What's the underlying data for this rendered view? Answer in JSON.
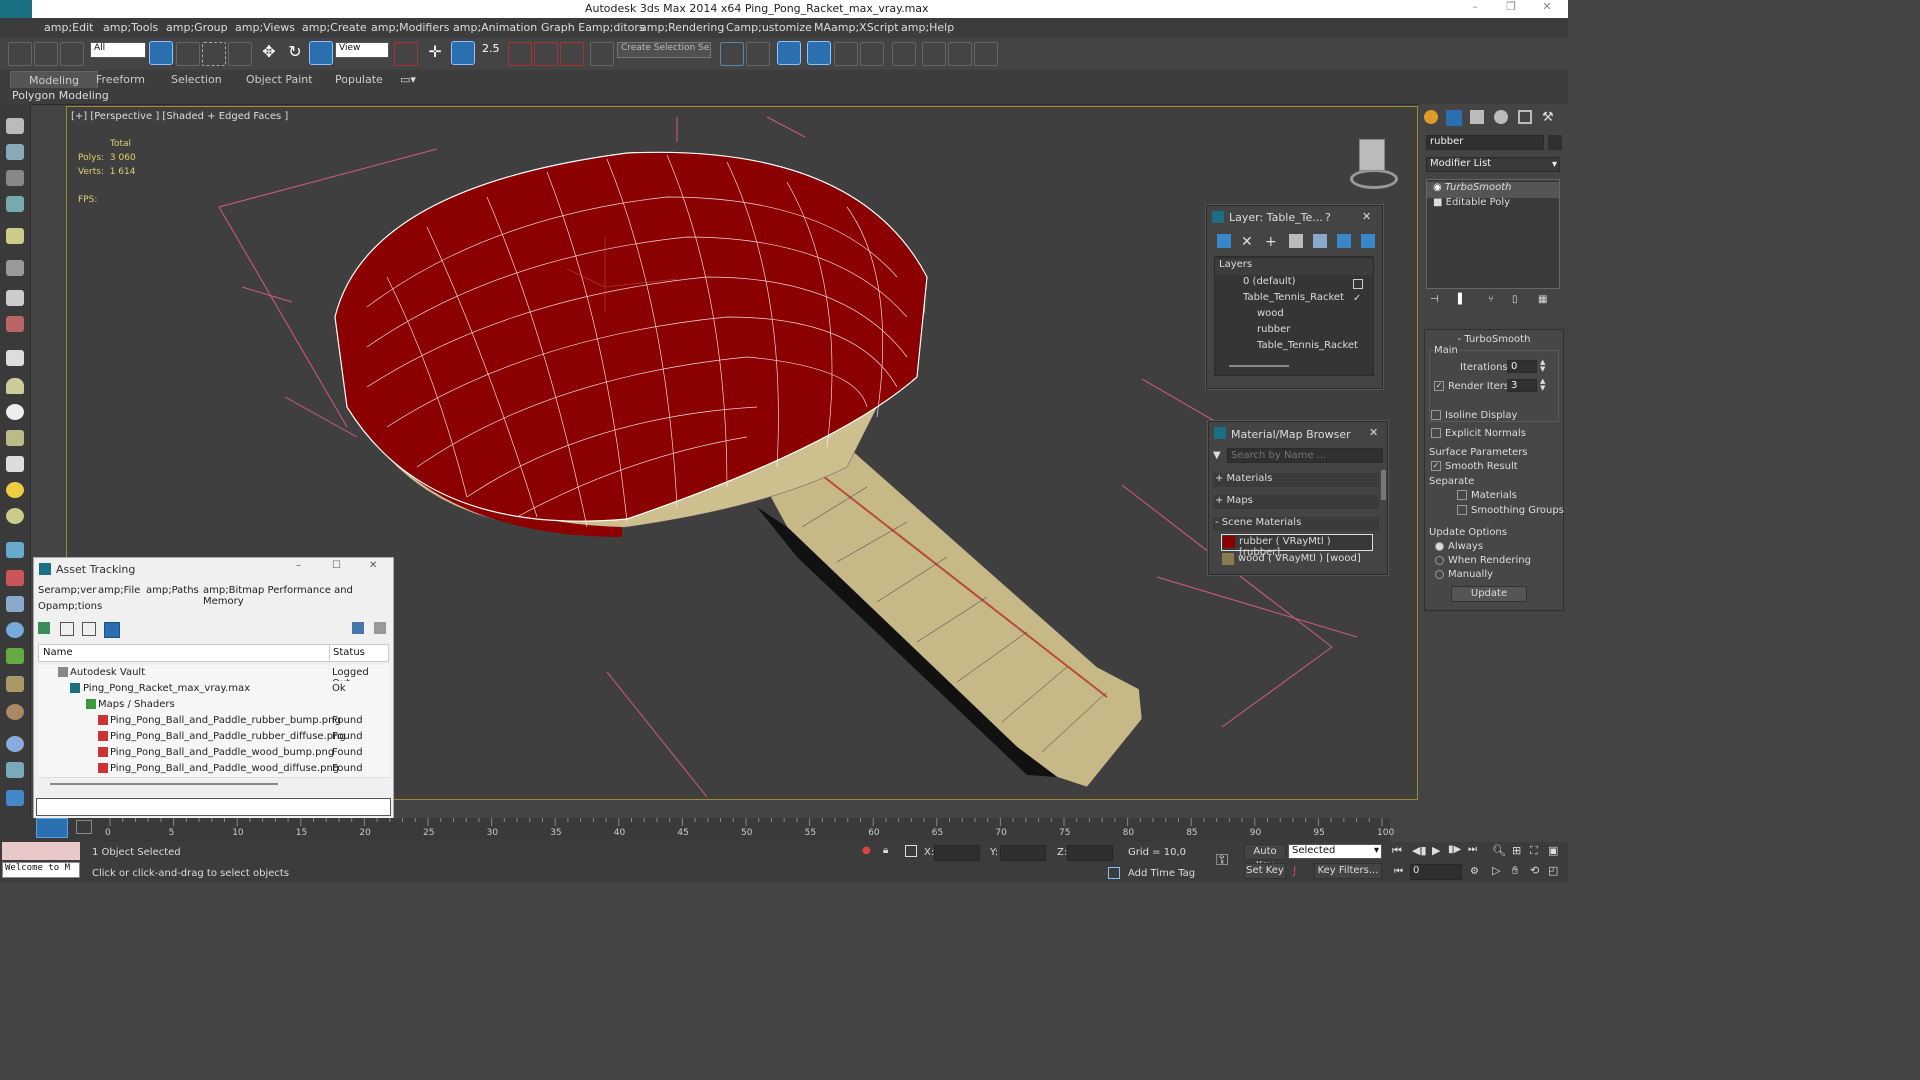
{
  "window": {
    "title": "Autodesk 3ds Max  2014 x64     Ping_Pong_Racket_max_vray.max"
  },
  "menu": [
    "amp;Edit",
    "amp;Tools",
    "amp;Group",
    "amp;Views",
    "amp;Create",
    "amp;Modifiers",
    "amp;Animation",
    "Graph Eamp;ditors",
    "amp;Rendering",
    "Camp;ustomize",
    "MAamp;XScript",
    "amp;Help"
  ],
  "toolbar": {
    "selection_filter": "All",
    "ref_coord": "View",
    "snap_label": "2.5",
    "named_selection": "Create Selection Se"
  },
  "ribbon": {
    "tabs": [
      "Modeling",
      "Freeform",
      "Selection",
      "Object Paint",
      "Populate"
    ],
    "subtab": "Polygon Modeling"
  },
  "viewport": {
    "label": "[+] [Perspective ] [Shaded + Edged Faces ]",
    "stats": {
      "total": "Total",
      "polys_label": "Polys:",
      "polys": "3 060",
      "verts_label": "Verts:",
      "verts": "1 614",
      "fps_label": "FPS:"
    },
    "colors": {
      "rubber": "#8b0000",
      "wood": "#cdbf8e",
      "wire": "#ffffff",
      "grid": "#d35a8a"
    }
  },
  "layer_dialog": {
    "title": "Layer: Table_Te...",
    "help": "?",
    "header": "Layers",
    "rows": [
      "0 (default)",
      "Table_Tennis_Racket",
      "wood",
      "rubber",
      "Table_Tennis_Racket"
    ]
  },
  "material_browser": {
    "title": "Material/Map Browser",
    "search_placeholder": "Search by Name ...",
    "sections": [
      "+ Materials",
      "+ Maps",
      "- Scene Materials"
    ],
    "items": [
      "rubber  ( VRayMtl )  [rubber]",
      "wood  ( VRayMtl )  [wood]"
    ]
  },
  "asset_tracking": {
    "title": "Asset Tracking",
    "menu": [
      "Seramp;ver",
      "amp;File",
      "amp;Paths",
      "amp;Bitmap Performance and Memory",
      "Opamp;tions"
    ],
    "columns": [
      "Name",
      "Status"
    ],
    "rows": [
      {
        "name": "Autodesk Vault",
        "status": "Logged Out ."
      },
      {
        "name": "Ping_Pong_Racket_max_vray.max",
        "status": "Ok"
      },
      {
        "name": "Maps / Shaders",
        "status": ""
      },
      {
        "name": "Ping_Pong_Ball_and_Paddle_rubber_bump.png",
        "status": "Found"
      },
      {
        "name": "Ping_Pong_Ball_and_Paddle_rubber_diffuse.png",
        "status": "Found"
      },
      {
        "name": "Ping_Pong_Ball_and_Paddle_wood_bump.png",
        "status": "Found"
      },
      {
        "name": "Ping_Pong_Ball_and_Paddle_wood_diffuse.png",
        "status": "Found"
      }
    ]
  },
  "command_panel": {
    "object_name": "rubber",
    "modifier_list": "Modifier List",
    "stack": [
      "TurboSmooth",
      "Editable Poly"
    ],
    "rollout": "TurboSmooth",
    "main": "Main",
    "iterations_label": "Iterations:",
    "iterations": "0",
    "render_iters_label": "Render Iters:",
    "render_iters": "3",
    "isoline": "Isoline Display",
    "explicit": "Explicit Normals",
    "surface": "Surface Parameters",
    "smooth_result": "Smooth Result",
    "separate": "Separate",
    "materials": "Materials",
    "smoothing_groups": "Smoothing Groups",
    "update_options": "Update Options",
    "always": "Always",
    "when_rendering": "When Rendering",
    "manually": "Manually",
    "update": "Update"
  },
  "timeline": {
    "ticks": [
      "0",
      "5",
      "10",
      "15",
      "20",
      "25",
      "30",
      "35",
      "40",
      "45",
      "50",
      "55",
      "60",
      "65",
      "70",
      "75",
      "80",
      "85",
      "90",
      "95",
      "100"
    ]
  },
  "status": {
    "welcome": "Welcome to M",
    "selected": "1 Object Selected",
    "prompt": "Click or click-and-drag to select objects",
    "x": "X:",
    "y": "Y:",
    "z": "Z:",
    "grid": "Grid = 10,0",
    "add_time_tag": "Add Time Tag",
    "auto_key": "Auto Key",
    "set_key": "Set Key",
    "selected_dd": "Selected",
    "key_filters": "Key Filters...",
    "frame": "0"
  }
}
